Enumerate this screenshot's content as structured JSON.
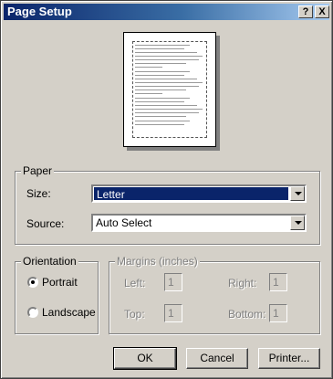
{
  "title": "Page Setup",
  "title_buttons": {
    "help": "?",
    "close": "X"
  },
  "paper": {
    "legend": "Paper",
    "size_label": "Size:",
    "size_value": "Letter",
    "source_label": "Source:",
    "source_value": "Auto Select"
  },
  "orientation": {
    "legend": "Orientation",
    "portrait": "Portrait",
    "landscape": "Landscape",
    "selected": "Portrait"
  },
  "margins": {
    "legend": "Margins (inches)",
    "left_label": "Left:",
    "left_value": "1",
    "right_label": "Right:",
    "right_value": "1",
    "top_label": "Top:",
    "top_value": "1",
    "bottom_label": "Bottom:",
    "bottom_value": "1"
  },
  "buttons": {
    "ok": "OK",
    "cancel": "Cancel",
    "printer": "Printer..."
  },
  "colors": {
    "title_active": "#0a246a",
    "dialog_face": "#d4d0c8",
    "selection": "#0a246a"
  }
}
